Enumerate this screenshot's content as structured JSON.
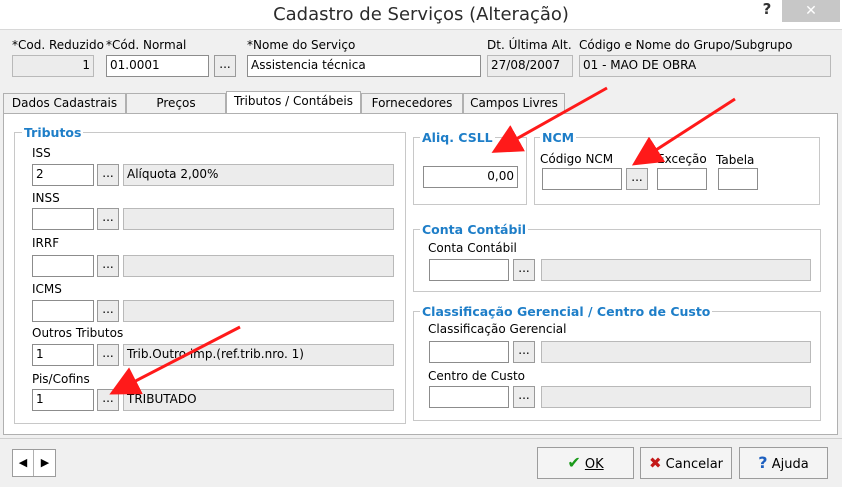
{
  "window": {
    "title": "Cadastro de Serviços (Alteração)",
    "help": "?",
    "close": "✕"
  },
  "header": {
    "cod_reduzido_label": "*Cod. Reduzido",
    "cod_reduzido_value": "1",
    "cod_normal_label": "*Cód. Normal",
    "cod_normal_value": "01.0001",
    "nome_label": "*Nome do Serviço",
    "nome_value": "Assistencia técnica",
    "dt_label": "Dt. Última Alt.",
    "dt_value": "27/08/2007",
    "grupo_label": "Código e Nome do Grupo/Subgrupo",
    "grupo_value": "01 - MAO DE OBRA"
  },
  "tabs": [
    {
      "label": "Dados Cadastrais"
    },
    {
      "label": "Preços"
    },
    {
      "label": "Tributos / Contábeis"
    },
    {
      "label": "Fornecedores"
    },
    {
      "label": "Campos Livres"
    }
  ],
  "tributos": {
    "title": "Tributos",
    "iss": {
      "label": "ISS",
      "code": "2",
      "desc": "Alíquota 2,00%"
    },
    "inss": {
      "label": "INSS",
      "code": "",
      "desc": ""
    },
    "irrf": {
      "label": "IRRF",
      "code": "",
      "desc": ""
    },
    "icms": {
      "label": "ICMS",
      "code": "",
      "desc": ""
    },
    "outros": {
      "label": "Outros Tributos",
      "code": "1",
      "desc": "Trib.Outro imp.(ref.trib.nro. 1)"
    },
    "pis": {
      "label": "Pis/Cofins",
      "code": "1",
      "desc": "TRIBUTADO"
    }
  },
  "csll": {
    "title": "Aliq. CSLL",
    "value": "0,00"
  },
  "ncm": {
    "title": "NCM",
    "codigo_label": "Código NCM",
    "excecao_label": "Exceção",
    "tabela_label": "Tabela"
  },
  "conta": {
    "title": "Conta Contábil",
    "label": "Conta Contábil"
  },
  "classif": {
    "title": "Classificação Gerencial / Centro de Custo",
    "classif_label": "Classificação Gerencial",
    "centro_label": "Centro de Custo"
  },
  "dots_label": "...",
  "footer": {
    "ok": "OK",
    "cancelar": "Cancelar",
    "ajuda": "Ajuda",
    "prev": "◀",
    "next": "▶"
  },
  "colors": {
    "accent": "#1e7ec8",
    "arrow": "#ff1a1a"
  }
}
